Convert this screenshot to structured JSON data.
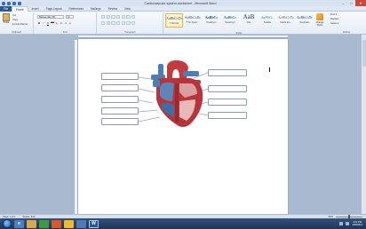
{
  "window": {
    "title": "Cardiovascular system worksheet - Microsoft Word",
    "controls": [
      "–",
      "□",
      "✕"
    ]
  },
  "tabs": [
    "File",
    "Home",
    "Insert",
    "Page Layout",
    "References",
    "Mailings",
    "Review",
    "View"
  ],
  "ribbon": {
    "clipboard": {
      "paste": "Paste",
      "cut": "Cut",
      "copy": "Copy",
      "format_painter": "Format Painter",
      "label": "Clipboard"
    },
    "font": {
      "name": "Baskerville Old",
      "size": "11",
      "label": "Font",
      "buttons": [
        "B",
        "I",
        "U",
        "abc",
        "x₂",
        "x²",
        "A",
        "A"
      ]
    },
    "paragraph": {
      "label": "Paragraph"
    },
    "styles": {
      "items": [
        {
          "preview": "AaBbCcDc",
          "name": "¶ Normal",
          "selected": true
        },
        {
          "preview": "AaBbCcDc",
          "name": "¶ No Spaci...",
          "selected": false
        },
        {
          "preview": "AaBbCc",
          "name": "Heading 1",
          "selected": false
        },
        {
          "preview": "AaBbCc",
          "name": "Heading 2",
          "selected": false
        },
        {
          "preview": "AaB",
          "name": "Title",
          "selected": false
        },
        {
          "preview": "AaBbCc.",
          "name": "Subtitle",
          "selected": false
        },
        {
          "preview": "AaBbCcDc",
          "name": "Subtle Em...",
          "selected": false
        },
        {
          "preview": "AaBbCcDc",
          "name": "Emphasis",
          "selected": false
        }
      ],
      "label": "Styles"
    },
    "change_styles": "Change Styles",
    "editing": {
      "find": "Find ▾",
      "replace": "Replace",
      "select": "Select ▾",
      "label": "Editing"
    }
  },
  "statusbar": {
    "page": "Page: 1 of 1",
    "words": "Words: 310",
    "zoom": "60%"
  },
  "taskbar": {
    "time": "2:21 PM",
    "date": "4/30/2014"
  },
  "colors": {
    "word_blue": "#2b5797",
    "heart_red": "#b8343b",
    "vessel_blue": "#4a7fb5"
  }
}
